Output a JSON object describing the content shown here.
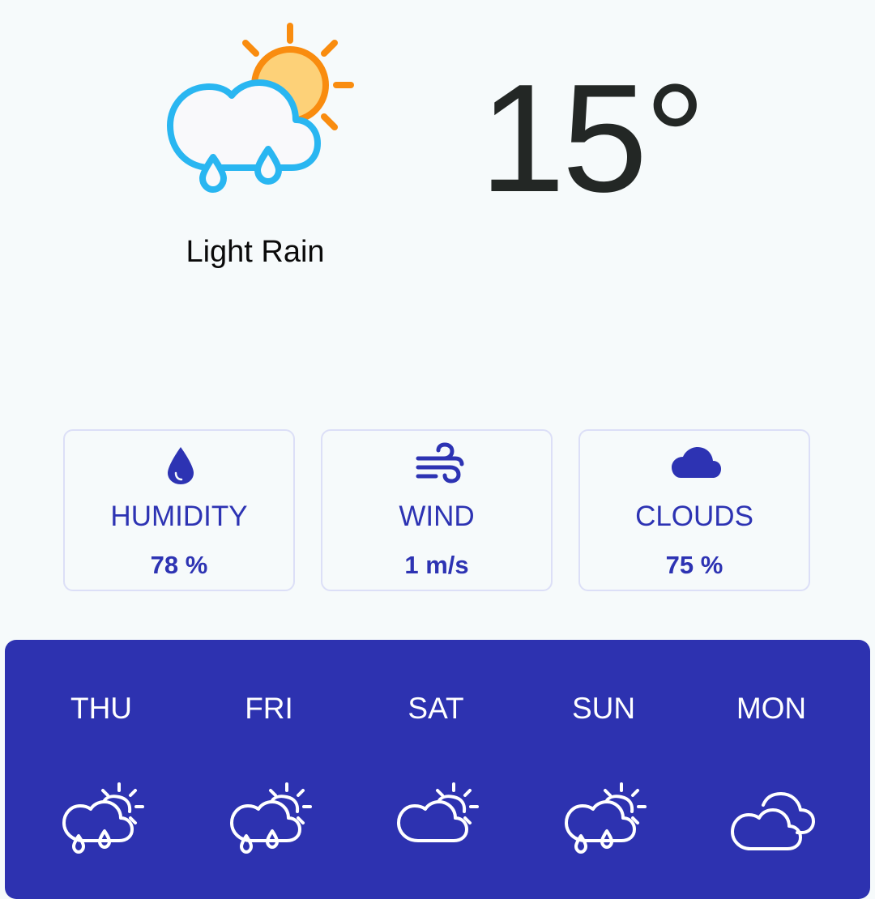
{
  "current": {
    "temperature": "15°",
    "condition": "Light Rain",
    "icon": "cloud-sun-rain-icon"
  },
  "stats": [
    {
      "label": "HUMIDITY",
      "value": "78 %",
      "icon": "water-drop-icon"
    },
    {
      "label": "WIND",
      "value": "1 m/s",
      "icon": "wind-icon"
    },
    {
      "label": "CLOUDS",
      "value": "75 %",
      "icon": "cloud-icon"
    }
  ],
  "forecast": [
    {
      "day": "THU",
      "icon": "cloud-sun-rain-icon"
    },
    {
      "day": "FRI",
      "icon": "cloud-sun-rain-icon"
    },
    {
      "day": "SAT",
      "icon": "cloud-sun-icon"
    },
    {
      "day": "SUN",
      "icon": "cloud-sun-rain-icon"
    },
    {
      "day": "MON",
      "icon": "cloudy-icon"
    }
  ],
  "colors": {
    "background": "#f6fafb",
    "accent": "#2d33b3",
    "forecast_panel": "#2d32b0",
    "card_border": "#dcdff7",
    "sun_orange": "#f98c0f",
    "sun_fill": "#fdd178",
    "cloud_blue": "#29b6f1",
    "temperature_text": "#232725"
  }
}
